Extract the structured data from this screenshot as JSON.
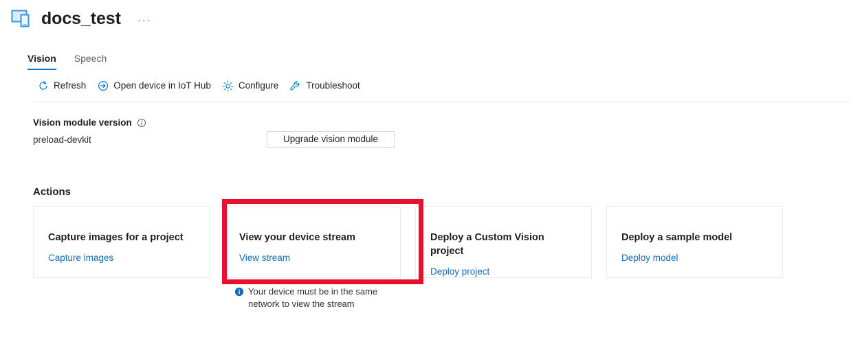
{
  "header": {
    "title": "docs_test",
    "icon": "devices-icon",
    "more_label": "···"
  },
  "tabs": [
    {
      "label": "Vision",
      "active": true
    },
    {
      "label": "Speech",
      "active": false
    }
  ],
  "commandbar": [
    {
      "label": "Refresh",
      "icon": "refresh-icon"
    },
    {
      "label": "Open device in IoT Hub",
      "icon": "arrow-circle-right-icon"
    },
    {
      "label": "Configure",
      "icon": "gear-icon"
    },
    {
      "label": "Troubleshoot",
      "icon": "wrench-icon"
    }
  ],
  "module": {
    "label": "Vision module version",
    "info_icon": "info-outline-icon",
    "value": "preload-devkit",
    "upgrade_button": "Upgrade vision module"
  },
  "actions": {
    "heading": "Actions",
    "cards": [
      {
        "title": "Capture images for a project",
        "link": "Capture images"
      },
      {
        "title": "View your device stream",
        "link": "View stream"
      },
      {
        "title": "Deploy a Custom Vision project",
        "link": "Deploy project"
      },
      {
        "title": "Deploy a sample model",
        "link": "Deploy model"
      }
    ]
  },
  "note": {
    "icon": "info-filled-icon",
    "text": "Your device must be in the same network to view the stream"
  },
  "colors": {
    "accent": "#0078d4",
    "link": "#0f6cbd",
    "annotation": "#e8112d",
    "text": "#201f1e"
  }
}
